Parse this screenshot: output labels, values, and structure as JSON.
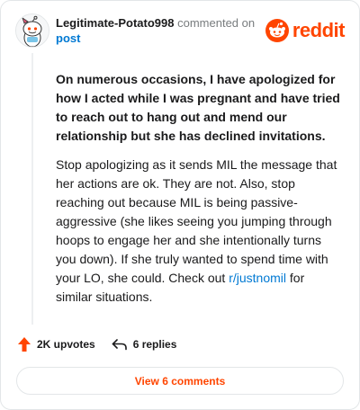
{
  "header": {
    "username": "Legitimate-Potato998",
    "commented_on": "commented on",
    "post_link": "post",
    "brand": "reddit"
  },
  "quote": "On numerous occasions, I have apologized for how I acted while I was pregnant and have tried to reach out to hang out and mend our relationship but she has declined invitations.",
  "comment": {
    "text_before_link": "Stop apologizing as it sends MIL the message that her actions are ok. They are not. Also, stop reaching out because MIL is being passive-aggressive (she likes seeing you jumping through hoops to engage her and she intentionally turns you down). If she truly wanted to spend time with your LO, she could. Check out ",
    "link": "r/justnomil",
    "text_after_link": " for similar situations."
  },
  "actions": {
    "upvotes": "2K upvotes",
    "replies": "6 replies"
  },
  "view_comments": "View 6 comments",
  "colors": {
    "brand_orange": "#ff4500",
    "link_blue": "#0079d3"
  }
}
